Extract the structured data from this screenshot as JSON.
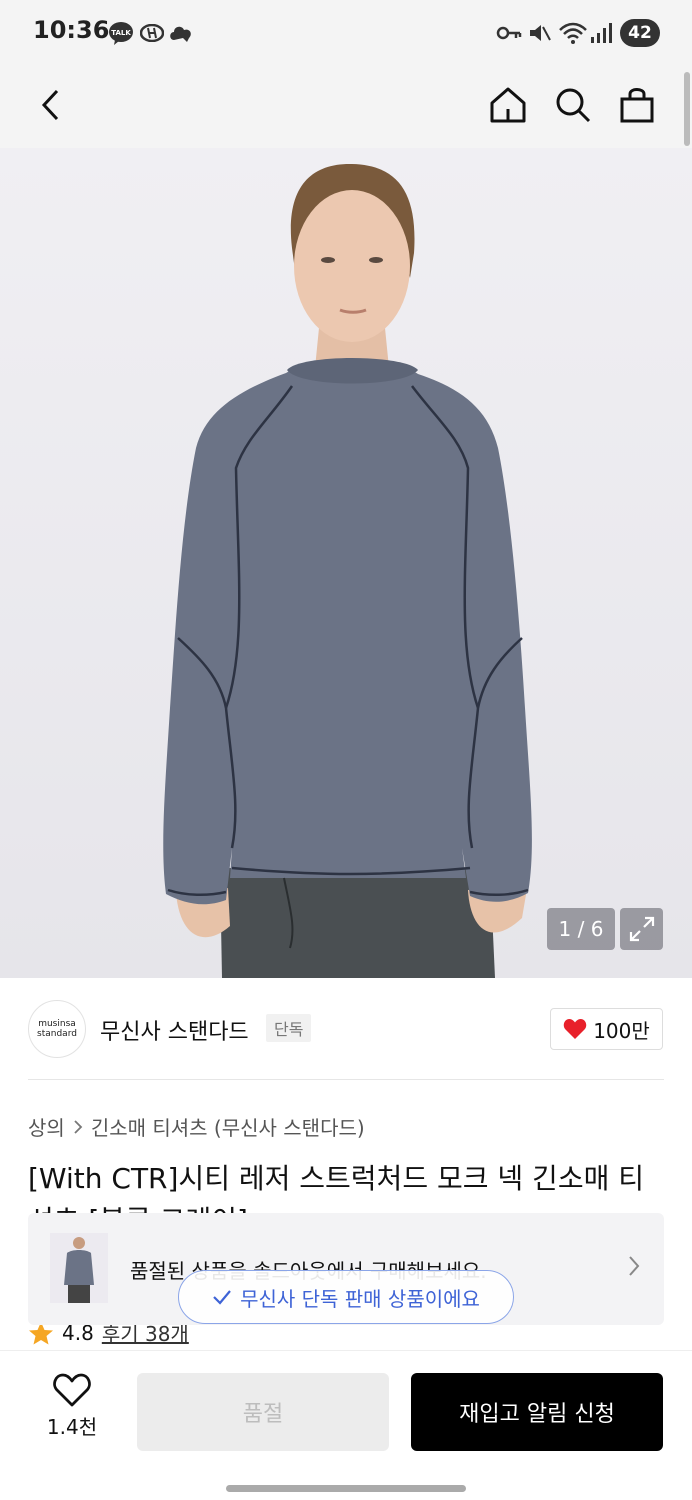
{
  "status_bar": {
    "time": "10:36",
    "battery": "42",
    "talk_label": "TALK"
  },
  "top_nav": {
    "icons": [
      "back-icon",
      "home-icon",
      "search-icon",
      "shopping-bag-icon"
    ]
  },
  "gallery": {
    "counter": "1 / 6"
  },
  "brand": {
    "logo_line1": "musinsa",
    "logo_line2": "standard",
    "name": "무신사 스탠다드",
    "tag": "단독",
    "likes": "100만"
  },
  "breadcrumb": {
    "category": "상의",
    "subcategory": "긴소매 티셔츠 (무신사 스탠다드)"
  },
  "product": {
    "title": "[With CTR]시티 레저 스트럭처드 모크 넥 긴소매 티셔츠 [블루 그레이]",
    "rating": "4.8",
    "reviews": "후기 38개"
  },
  "soldout_banner": {
    "text": "품절된 상품을 솔드아웃에서 구매해보세요."
  },
  "toast": {
    "text": "무신사 단독 판매 상품이에요"
  },
  "bottom_bar": {
    "wish_count": "1.4천",
    "soldout_label": "품절",
    "restock_label": "재입고 알림 신청"
  },
  "colors": {
    "accent_heart": "#e8202a",
    "star": "#f5a623",
    "toast_blue": "#3e63d6",
    "shirt": "#6b7386"
  }
}
